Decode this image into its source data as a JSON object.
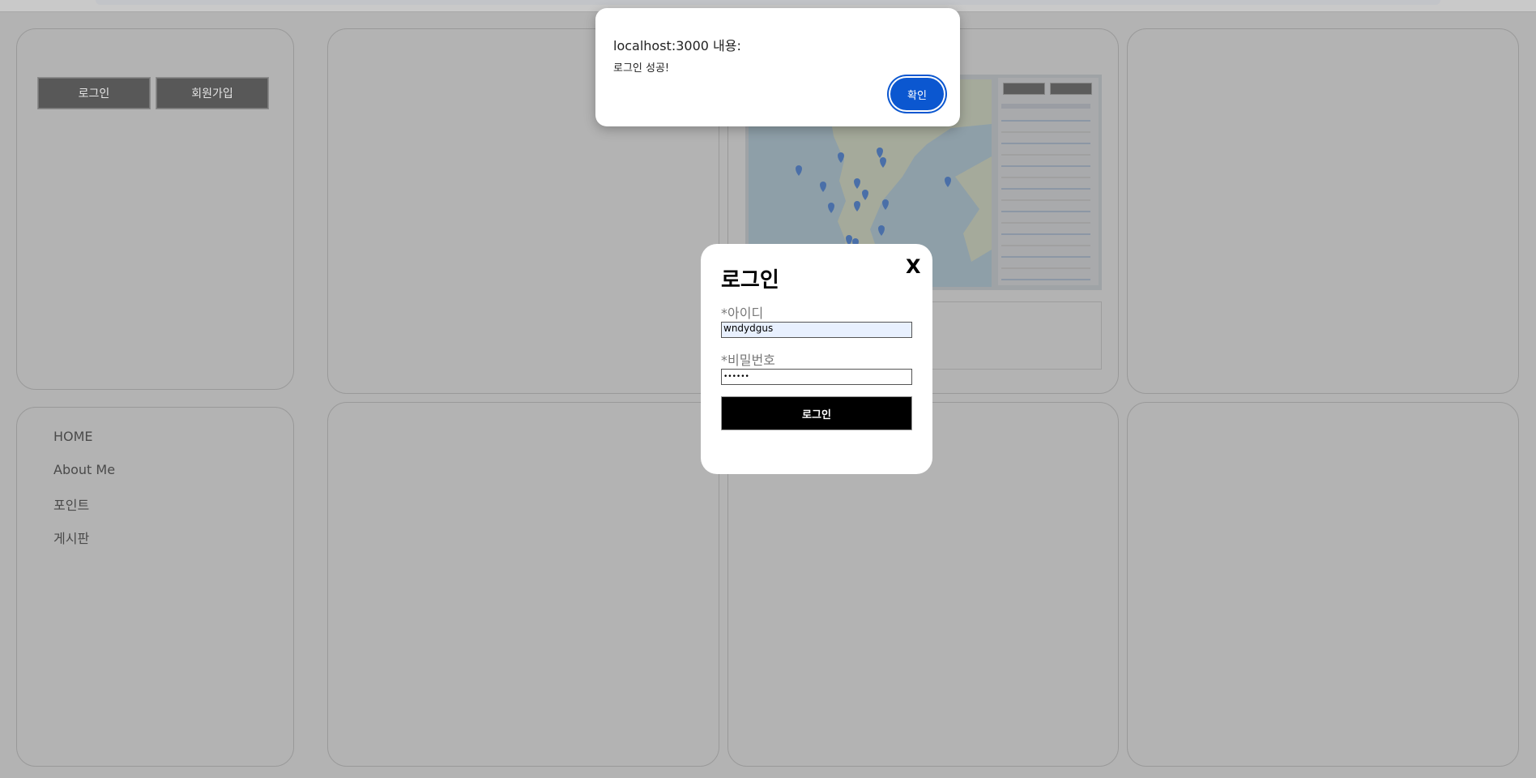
{
  "header": {
    "login_button": "로그인",
    "signup_button": "회원가입"
  },
  "nav": {
    "items": [
      {
        "label": "HOME"
      },
      {
        "label": "About Me"
      },
      {
        "label": "포인트"
      },
      {
        "label": "게시판"
      }
    ]
  },
  "alert": {
    "title": "localhost:3000 내용:",
    "message": "로그인 성공!",
    "ok_button": "확인"
  },
  "login_modal": {
    "close_label": "X",
    "title": "로그인",
    "id_label": "*아이디",
    "id_value": "wndydgus",
    "password_label": "*비밀번호",
    "password_value": "••••••",
    "submit_button": "로그인"
  },
  "colors": {
    "overlay": "#b3b3b3",
    "alert_accent": "#0b57d0",
    "submit_button": "#000000",
    "autofill_background": "#e8f0fe"
  },
  "icons": [
    "map-pin-icon"
  ]
}
